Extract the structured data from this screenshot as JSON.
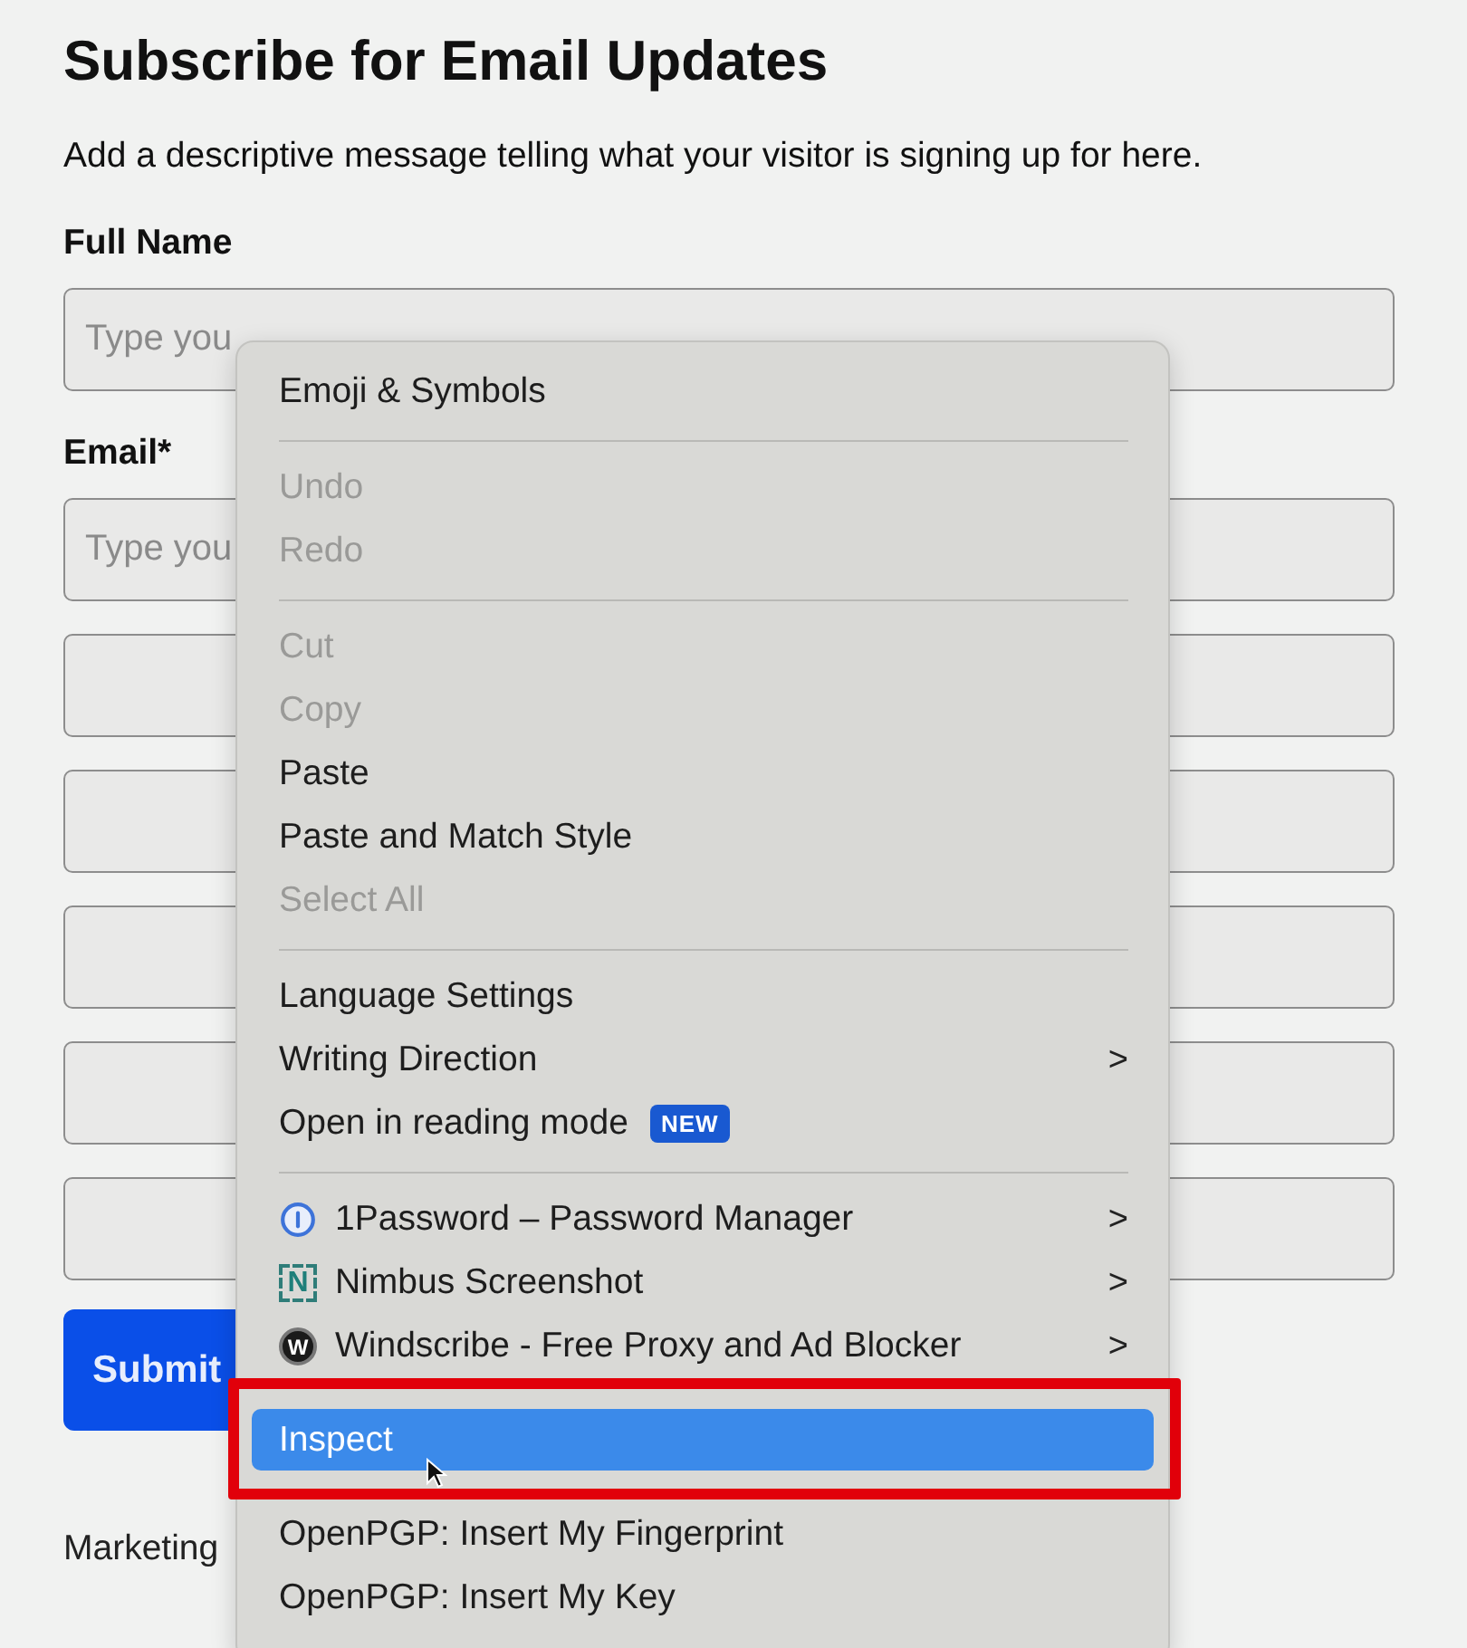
{
  "form": {
    "title": "Subscribe for Email Updates",
    "description": "Add a descriptive message telling what your visitor is signing up for here.",
    "fields": [
      {
        "kind": "text",
        "label": "Full Name",
        "placeholder": "Type you"
      },
      {
        "kind": "text",
        "label": "Email*",
        "placeholder": "Type you"
      },
      {
        "kind": "blank"
      },
      {
        "kind": "blank"
      },
      {
        "kind": "blank"
      },
      {
        "kind": "blank"
      },
      {
        "kind": "blank"
      }
    ],
    "submit": "Submit",
    "footer": "Marketing"
  },
  "context_menu": {
    "items": [
      {
        "kind": "item",
        "label": "Emoji & Symbols",
        "disabled": false,
        "submenu": false,
        "selected": false
      },
      {
        "kind": "separator"
      },
      {
        "kind": "item",
        "label": "Undo",
        "disabled": true,
        "submenu": false,
        "selected": false
      },
      {
        "kind": "item",
        "label": "Redo",
        "disabled": true,
        "submenu": false,
        "selected": false
      },
      {
        "kind": "separator"
      },
      {
        "kind": "item",
        "label": "Cut",
        "disabled": true,
        "submenu": false,
        "selected": false
      },
      {
        "kind": "item",
        "label": "Copy",
        "disabled": true,
        "submenu": false,
        "selected": false
      },
      {
        "kind": "item",
        "label": "Paste",
        "disabled": false,
        "submenu": false,
        "selected": false
      },
      {
        "kind": "item",
        "label": "Paste and Match Style",
        "disabled": false,
        "submenu": false,
        "selected": false
      },
      {
        "kind": "item",
        "label": "Select All",
        "disabled": true,
        "submenu": false,
        "selected": false
      },
      {
        "kind": "separator"
      },
      {
        "kind": "item",
        "label": "Language Settings",
        "disabled": false,
        "submenu": false,
        "selected": false
      },
      {
        "kind": "item",
        "label": "Writing Direction",
        "disabled": false,
        "submenu": true,
        "selected": false
      },
      {
        "kind": "item",
        "label": "Open in reading mode",
        "badge": "NEW",
        "disabled": false,
        "submenu": false,
        "selected": false
      },
      {
        "kind": "separator"
      },
      {
        "kind": "extension",
        "label": "1Password – Password Manager",
        "disabled": false,
        "submenu": true,
        "selected": false
      },
      {
        "kind": "extension",
        "label": "Nimbus Screenshot",
        "icon_glyph": "N",
        "disabled": false,
        "submenu": true,
        "selected": false
      },
      {
        "kind": "extension",
        "label": "Windscribe - Free Proxy and Ad Blocker",
        "icon_glyph": "W",
        "disabled": false,
        "submenu": true,
        "selected": false
      },
      {
        "kind": "item",
        "label": "Inspect",
        "disabled": false,
        "submenu": false,
        "selected": true,
        "annotated": true
      },
      {
        "kind": "item",
        "label": "OpenPGP: Insert My Fingerprint",
        "disabled": false,
        "submenu": false,
        "selected": false
      },
      {
        "kind": "item",
        "label": "OpenPGP: Insert My Key",
        "disabled": false,
        "submenu": false,
        "selected": false
      }
    ],
    "submenu_arrow": ">"
  }
}
